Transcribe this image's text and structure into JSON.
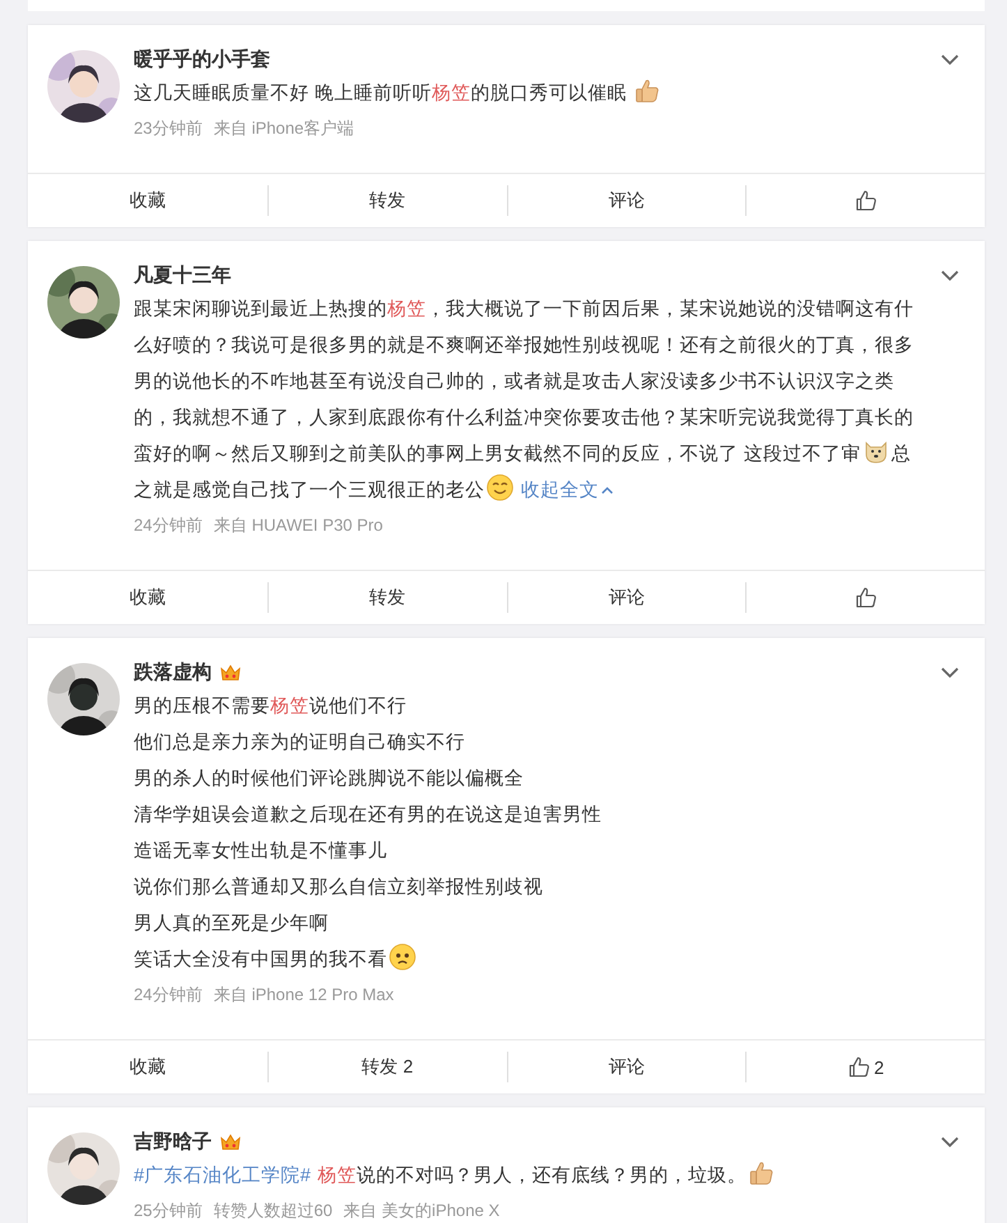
{
  "posts": [
    {
      "name": "暖乎乎的小手套",
      "vip": false,
      "paragraphs": [
        [
          {
            "kind": "text",
            "text": "这几天睡眠质量不好 晚上睡前听听"
          },
          {
            "kind": "mention",
            "text": "杨笠"
          },
          {
            "kind": "text",
            "text": "的脱口秀可以催眠 "
          },
          {
            "kind": "emoji-thumb"
          }
        ]
      ],
      "meta": [
        "23分钟前",
        "来自 iPhone客户端"
      ],
      "actions": [
        {
          "kind": "text",
          "label": "收藏"
        },
        {
          "kind": "text",
          "label": "转发"
        },
        {
          "kind": "text",
          "label": "评论"
        },
        {
          "kind": "like"
        }
      ]
    },
    {
      "name": "凡夏十三年",
      "vip": false,
      "paragraphs": [
        [
          {
            "kind": "text",
            "text": "跟某宋闲聊说到最近上热搜的"
          },
          {
            "kind": "mention",
            "text": "杨笠"
          },
          {
            "kind": "text",
            "text": "，我大概说了一下前因后果，某宋说她说的没错啊这有什么好喷的？我说可是很多男的就是不爽啊还举报她性别歧视呢！还有之前很火的丁真，很多男的说他长的不咋地甚至有说没自己帅的，或者就是攻击人家没读多少书不认识汉字之类的，我就想不通了，人家到底跟你有什么利益冲突你要攻击他？某宋听完说我觉得丁真长的蛮好的啊～然后又聊到之前美队的事网上男女截然不同的反应，不说了 这段过不了审"
          },
          {
            "kind": "emoji-dog"
          },
          {
            "kind": "text",
            "text": "总之就是感觉自己找了一个三观很正的老公"
          },
          {
            "kind": "emoji-smile"
          },
          {
            "kind": "collapse",
            "text": "收起全文"
          }
        ]
      ],
      "meta": [
        "24分钟前",
        "来自 HUAWEI P30 Pro"
      ],
      "actions": [
        {
          "kind": "text",
          "label": "收藏"
        },
        {
          "kind": "text",
          "label": "转发"
        },
        {
          "kind": "text",
          "label": "评论"
        },
        {
          "kind": "like"
        }
      ]
    },
    {
      "name": "跌落虚构",
      "vip": true,
      "paragraphs": [
        [
          {
            "kind": "text",
            "text": "男的压根不需要"
          },
          {
            "kind": "mention",
            "text": "杨笠"
          },
          {
            "kind": "text",
            "text": "说他们不行"
          }
        ],
        [
          {
            "kind": "text",
            "text": "他们总是亲力亲为的证明自己确实不行"
          }
        ],
        [
          {
            "kind": "text",
            "text": "男的杀人的时候他们评论跳脚说不能以偏概全"
          }
        ],
        [
          {
            "kind": "text",
            "text": "清华学姐误会道歉之后现在还有男的在说这是迫害男性"
          }
        ],
        [
          {
            "kind": "text",
            "text": "造谣无辜女性出轨是不懂事儿"
          }
        ],
        [
          {
            "kind": "text",
            "text": "说你们那么普通却又那么自信立刻举报性别歧视"
          }
        ],
        [
          {
            "kind": "text",
            "text": "男人真的至死是少年啊"
          }
        ],
        [
          {
            "kind": "text",
            "text": "笑话大全没有中国男的我不看"
          },
          {
            "kind": "emoji-sad"
          }
        ]
      ],
      "meta": [
        "24分钟前",
        "来自 iPhone 12 Pro Max"
      ],
      "actions": [
        {
          "kind": "text",
          "label": "收藏"
        },
        {
          "kind": "text",
          "label": "转发 2"
        },
        {
          "kind": "text",
          "label": "评论"
        },
        {
          "kind": "like",
          "label": "2"
        }
      ]
    },
    {
      "name": "吉野晗子",
      "vip": true,
      "paragraphs": [
        [
          {
            "kind": "link",
            "text": "#广东石油化工学院#"
          },
          {
            "kind": "mention",
            "text": "杨笠"
          },
          {
            "kind": "text",
            "text": "说的不对吗？男人，还有底线？男的，垃圾。"
          },
          {
            "kind": "emoji-thumb"
          }
        ]
      ],
      "meta": [
        "25分钟前",
        "转赞人数超过60",
        "来自 美女的iPhone X"
      ]
    }
  ]
}
